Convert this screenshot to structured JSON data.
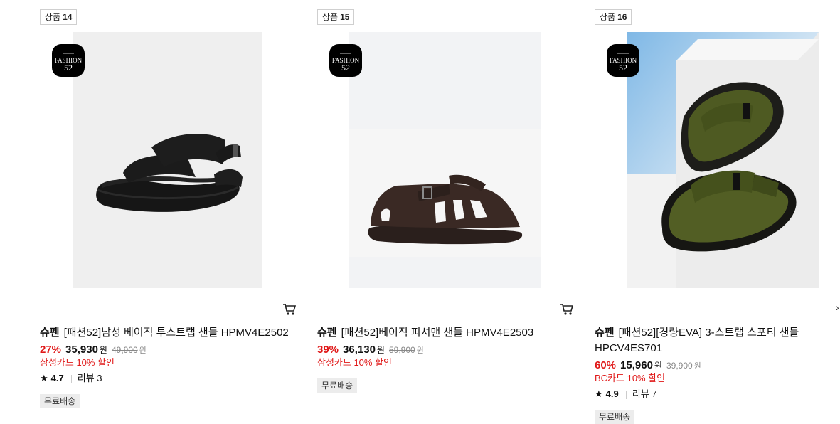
{
  "products": [
    {
      "badge_label": "상품",
      "badge_number": "14",
      "logo_text": "FASHION",
      "logo_number": "52",
      "brand": "슈펜",
      "name": "[패션52]남성 베이직 투스트랩 샌들 HPMV4E2502",
      "discount": "27%",
      "price": "35,930",
      "currency": "원",
      "original_price": "49,900",
      "original_currency": "원",
      "promo": "삼성카드 10% 할인",
      "rating": "4.7",
      "reviews": "리뷰 3",
      "shipping": "무료배송"
    },
    {
      "badge_label": "상품",
      "badge_number": "15",
      "logo_text": "FASHION",
      "logo_number": "52",
      "brand": "슈펜",
      "name": "[패션52]베이직 피셔맨 샌들 HPMV4E2503",
      "discount": "39%",
      "price": "36,130",
      "currency": "원",
      "original_price": "59,900",
      "original_currency": "원",
      "promo": "삼성카드 10% 할인",
      "shipping": "무료배송"
    },
    {
      "badge_label": "상품",
      "badge_number": "16",
      "logo_text": "FASHION",
      "logo_number": "52",
      "brand": "슈펜",
      "name_line1": "[패션52][경량EVA] 3-스트랩 스포티 샌들",
      "name_line2": "HPCV4ES701",
      "discount": "60%",
      "price": "15,960",
      "currency": "원",
      "original_price": "39,900",
      "original_currency": "원",
      "promo": "BC카드 10% 할인",
      "rating": "4.9",
      "reviews": "리뷰 7",
      "shipping": "무료배송"
    }
  ],
  "icons": {
    "cart": "cart-icon",
    "star": "star-icon",
    "next": "chevron-right-icon"
  },
  "colors": {
    "discount": "#e01818",
    "promo": "#e01818",
    "chip_bg": "#ececec",
    "logo_bg": "#000000"
  }
}
